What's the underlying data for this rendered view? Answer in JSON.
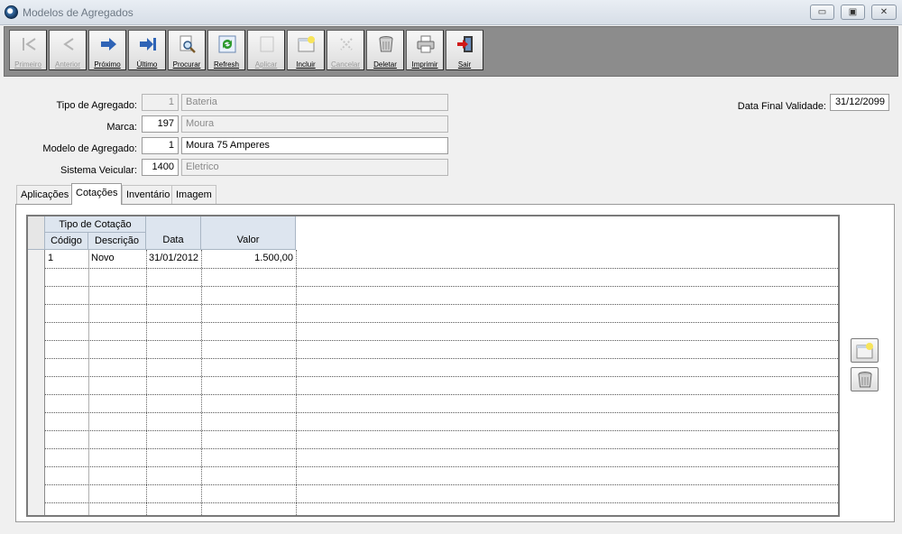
{
  "window": {
    "title": "Modelos de Agregados",
    "minimize_glyph": "▭",
    "maximize_glyph": "▣",
    "close_glyph": "✕"
  },
  "toolbar": [
    {
      "label": "Primeiro",
      "icon": "first-icon",
      "enabled": false
    },
    {
      "label": "Anterior",
      "icon": "previous-icon",
      "enabled": false
    },
    {
      "label": "Próximo",
      "icon": "next-icon",
      "enabled": true
    },
    {
      "label": "Último",
      "icon": "last-icon",
      "enabled": true
    },
    {
      "label": "Procurar",
      "icon": "search-icon",
      "enabled": true
    },
    {
      "label": "Refresh",
      "icon": "refresh-icon",
      "enabled": true
    },
    {
      "label": "Aplicar",
      "icon": "apply-icon",
      "enabled": false
    },
    {
      "label": "Incluir",
      "icon": "add-icon",
      "enabled": true
    },
    {
      "label": "Cancelar",
      "icon": "cancel-icon",
      "enabled": false
    },
    {
      "label": "Deletar",
      "icon": "trash-icon",
      "enabled": true
    },
    {
      "label": "Imprimir",
      "icon": "printer-icon",
      "enabled": true
    },
    {
      "label": "Sair",
      "icon": "exit-icon",
      "enabled": true
    }
  ],
  "form": {
    "tipo_agregado": {
      "label": "Tipo de Agregado:",
      "code": "1",
      "description": "Bateria"
    },
    "marca": {
      "label": "Marca:",
      "code": "197",
      "description": "Moura"
    },
    "modelo_agregado": {
      "label": "Modelo de Agregado:",
      "code": "1",
      "description": "Moura 75 Amperes"
    },
    "sistema_veicular": {
      "label": "Sistema Veicular:",
      "code": "1400",
      "description": "Eletrico"
    },
    "data_final_validade": {
      "label": "Data Final Validade:",
      "value": "31/12/2099"
    }
  },
  "tabs": [
    {
      "label": "Aplicações",
      "active": false
    },
    {
      "label": "Cotações",
      "active": true
    },
    {
      "label": "Inventário",
      "active": false
    },
    {
      "label": "Imagem",
      "active": false
    }
  ],
  "grid": {
    "group_header": "Tipo de Cotação",
    "columns": [
      "Código",
      "Descrição",
      "Data",
      "Valor"
    ],
    "rows": [
      [
        "1",
        "Novo",
        "31/01/2012",
        "1.500,00"
      ]
    ]
  },
  "colors": {
    "toolbar_bg": "#8c8c8c",
    "header_bg": "#dde5ef",
    "arrow_blue": "#2f64b6",
    "exit_red": "#d01818"
  }
}
